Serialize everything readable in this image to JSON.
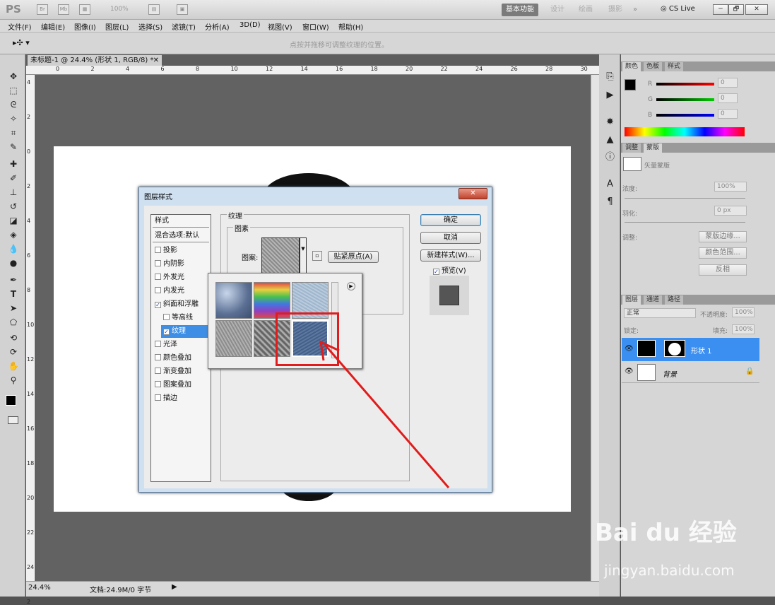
{
  "app": {
    "logo": "PS",
    "title_icons": [
      "Br",
      "Mb"
    ],
    "zoom": "100%"
  },
  "workspaces": {
    "items": [
      "基本功能",
      "设计",
      "绘画",
      "摄影"
    ],
    "more": "»",
    "cslive": "CS Live"
  },
  "window_buttons": [
    "─",
    "🗗",
    "✕"
  ],
  "menu": [
    "文件(F)",
    "编辑(E)",
    "图像(I)",
    "图层(L)",
    "选择(S)",
    "滤镜(T)",
    "分析(A)",
    "3D(D)",
    "视图(V)",
    "窗口(W)",
    "帮助(H)"
  ],
  "options": {
    "hint": "点按并拖移可调整纹理的位置。"
  },
  "document": {
    "tab_title": "未标题-1 @ 24.4% (形状 1, RGB/8) *",
    "close": "✕"
  },
  "ruler": {
    "top": [
      "0",
      "2",
      "4",
      "6",
      "8",
      "10",
      "12",
      "14",
      "16",
      "18",
      "20",
      "22",
      "24",
      "26",
      "28",
      "30"
    ],
    "left": [
      "4",
      "2",
      "0",
      "2",
      "4",
      "6",
      "8",
      "10",
      "12",
      "14",
      "16",
      "18",
      "20",
      "22",
      "24",
      "2"
    ]
  },
  "status": {
    "zoom": "24.4%",
    "doc": "文档:24.9M/0 字节"
  },
  "dialog": {
    "title": "图层样式",
    "close": "✕",
    "styles_header": "样式",
    "blend_default": "混合选项:默认",
    "styles": [
      {
        "label": "投影",
        "checked": false,
        "sub": false,
        "selected": false
      },
      {
        "label": "内阴影",
        "checked": false,
        "sub": false,
        "selected": false
      },
      {
        "label": "外发光",
        "checked": false,
        "sub": false,
        "selected": false
      },
      {
        "label": "内发光",
        "checked": false,
        "sub": false,
        "selected": false
      },
      {
        "label": "斜面和浮雕",
        "checked": true,
        "sub": false,
        "selected": false
      },
      {
        "label": "等高线",
        "checked": false,
        "sub": true,
        "selected": false
      },
      {
        "label": "纹理",
        "checked": true,
        "sub": true,
        "selected": true
      },
      {
        "label": "光泽",
        "checked": false,
        "sub": false,
        "selected": false
      },
      {
        "label": "颜色叠加",
        "checked": false,
        "sub": false,
        "selected": false
      },
      {
        "label": "渐变叠加",
        "checked": false,
        "sub": false,
        "selected": false
      },
      {
        "label": "图案叠加",
        "checked": false,
        "sub": false,
        "selected": false
      },
      {
        "label": "描边",
        "checked": false,
        "sub": false,
        "selected": false
      }
    ],
    "texture_group": "纹理",
    "pattern_group": "图素",
    "pattern_label": "图案:",
    "snap_origin": "贴紧原点(A)",
    "ok": "确定",
    "cancel": "取消",
    "new_style": "新建样式(W)...",
    "preview": "预览(V)",
    "preview_checked": true
  },
  "swatches": [
    {
      "name": "bubbles",
      "color": "#7d95b8"
    },
    {
      "name": "rainbow",
      "color": "#8a6bd0"
    },
    {
      "name": "blue-grain",
      "color": "#a8bed2"
    },
    {
      "name": "gray-noise",
      "color": "#9a9a9a"
    },
    {
      "name": "gray-weave",
      "color": "#7a7a7a"
    },
    {
      "name": "denim",
      "color": "#4f6a8f"
    }
  ],
  "color_panel": {
    "tabs": [
      "颜色",
      "色板",
      "样式"
    ],
    "channels": [
      {
        "label": "R",
        "value": "0"
      },
      {
        "label": "G",
        "value": "0"
      },
      {
        "label": "B",
        "value": "0"
      }
    ]
  },
  "adjust_panel": {
    "tabs": [
      "调整",
      "蒙版"
    ],
    "mask_label": "矢量蒙版",
    "density_label": "浓度:",
    "density": "100%",
    "feather_label": "羽化:",
    "feather": "0 px",
    "refine_label": "调整:",
    "btn_edge": "蒙版边缘...",
    "btn_range": "颜色范围...",
    "btn_invert": "反相"
  },
  "layers_panel": {
    "tabs": [
      "图层",
      "通道",
      "路径"
    ],
    "blend": "正常",
    "opacity_label": "不透明度:",
    "opacity": "100%",
    "lock_label": "锁定:",
    "fill_label": "填充:",
    "fill": "100%",
    "layers": [
      {
        "name": "形状 1",
        "selected": true
      },
      {
        "name": "背景",
        "selected": false
      }
    ]
  },
  "watermark": {
    "brand": "Bai du 经验",
    "url": "jingyan.baidu.com"
  }
}
